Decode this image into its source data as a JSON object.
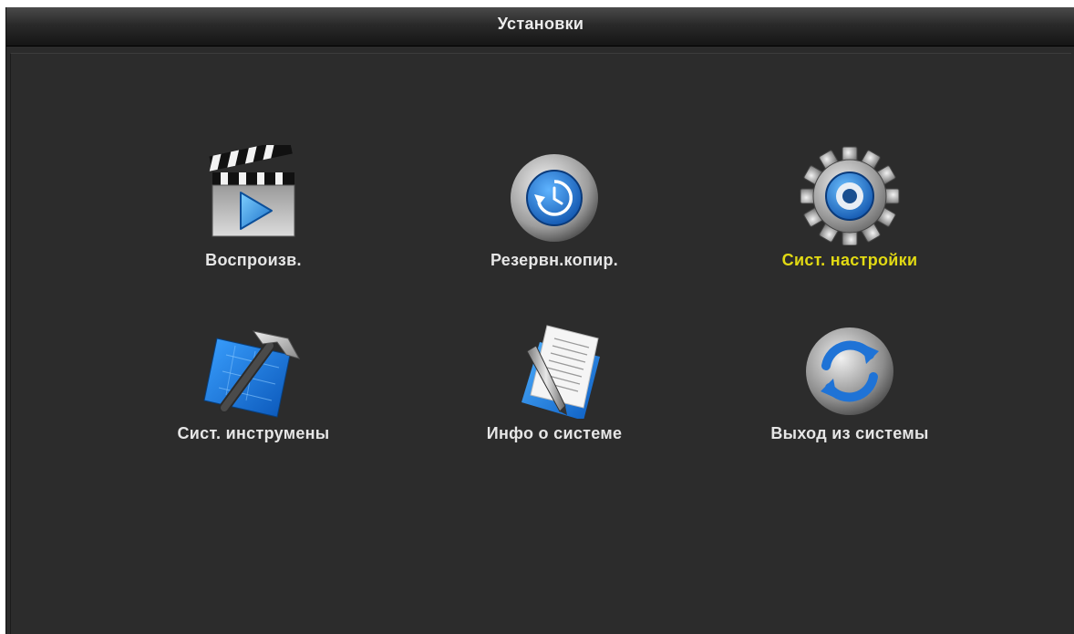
{
  "window": {
    "title": "Установки"
  },
  "menu": {
    "items": [
      {
        "id": "playback",
        "label": "Воспроизв.",
        "icon": "clapperboard-icon"
      },
      {
        "id": "backup",
        "label": "Резервн.копир.",
        "icon": "backup-restore-icon"
      },
      {
        "id": "settings",
        "label": "Сист. настройки",
        "icon": "gear-icon",
        "active": true
      },
      {
        "id": "tools",
        "label": "Сист. инструмены",
        "icon": "hammer-blueprint-icon"
      },
      {
        "id": "info",
        "label": "Инфо о системе",
        "icon": "document-pen-icon"
      },
      {
        "id": "logout",
        "label": "Выход из системы",
        "icon": "refresh-circle-icon"
      }
    ]
  },
  "colors": {
    "active_label": "#e2da13",
    "label": "#e6e6e6",
    "background": "#2c2c2c"
  }
}
